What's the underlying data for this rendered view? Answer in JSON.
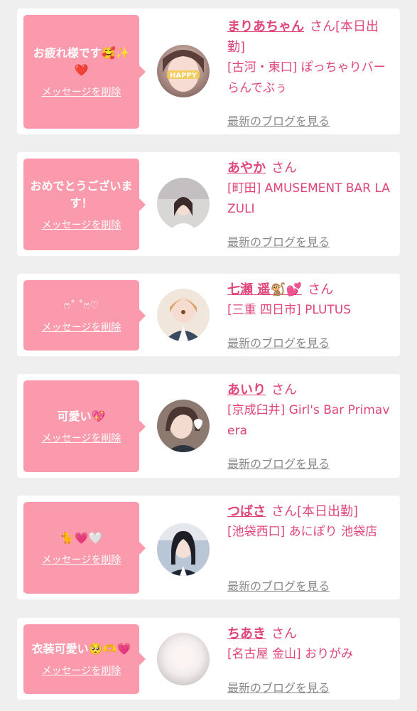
{
  "delete_label": "メッセージを削除",
  "blog_label": "最新のブログを見る",
  "san_label": "さん",
  "colors": {
    "background": "#efefef",
    "bubble": "#fa9aac",
    "accent": "#e0457b",
    "muted_link": "#8a8a8a"
  },
  "cards": [
    {
      "message": "お疲れ様です🥰✨❤️",
      "name": "まりあちゃん",
      "status": "[本日出勤]",
      "shop": "[古河・東口] ぽっちゃりバー らんでぶぅ",
      "avatar_text": "HAPPY"
    },
    {
      "message": "おめでとうございます！",
      "name": "あやか",
      "status": "",
      "shop": "[町田] AMUSEMENT BAR LAZULI",
      "avatar_text": ""
    },
    {
      "message": "ෆ˚ ˚ෆ♡",
      "name": "七瀬 遥🐒💕",
      "status": "",
      "shop": "[三重 四日市] PLUTUS",
      "avatar_text": ""
    },
    {
      "message": "可愛い💖",
      "name": "あいり",
      "status": "",
      "shop": "[京成臼井] Girl's Bar Primavera",
      "avatar_text": ""
    },
    {
      "message": "🐈💗🤍",
      "name": "つばさ",
      "status": "[本日出勤]",
      "shop": "[池袋西口] あにぽり 池袋店",
      "avatar_text": ""
    },
    {
      "message": "衣装可愛い🥺🫶💗",
      "name": "ちあき",
      "status": "",
      "shop": "[名古屋 金山] おりがみ",
      "avatar_text": ""
    }
  ]
}
